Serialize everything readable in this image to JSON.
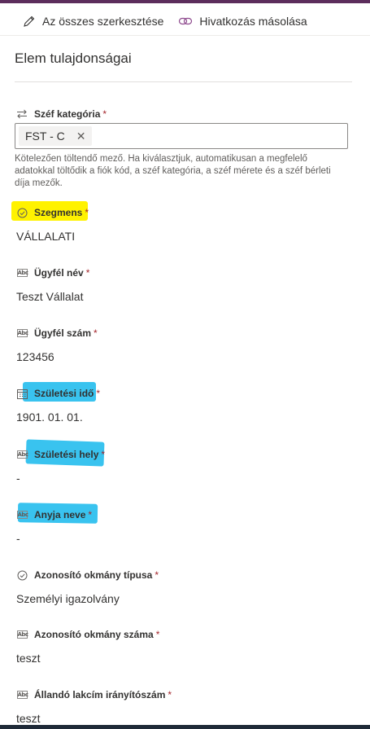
{
  "toolbar": {
    "edit_all_label": "Az összes szerkesztése",
    "copy_link_label": "Hivatkozás másolása"
  },
  "panel": {
    "title": "Elem tulajdonságai"
  },
  "fields": {
    "safe_category": {
      "label": "Széf kategória",
      "required": "*",
      "chip": "FST - C",
      "help": "Kötelezően töltendő mező. Ha kiválasztjuk, automatikusan a megfelelő adatokkal töltődik a fiók kód, a széf kategória, a széf mérete és a széf bérleti díja mezők."
    },
    "segment": {
      "label": "Szegmens",
      "required": "*",
      "value": "VÁLLALATI"
    },
    "client_name": {
      "label": "Ügyfél név",
      "required": "*",
      "value": "Teszt Vállalat"
    },
    "client_number": {
      "label": "Ügyfél szám",
      "required": "*",
      "value": "123456"
    },
    "birth_date": {
      "label": "Születési idő",
      "required": "*",
      "value": "1901. 01. 01."
    },
    "birth_place": {
      "label": "Születési hely",
      "required": "*",
      "value": "-"
    },
    "mother_name": {
      "label": "Anyja neve",
      "required": "*",
      "value": "-"
    },
    "id_doc_type": {
      "label": "Azonosító okmány típusa",
      "required": "*",
      "value": "Személyi igazolvány"
    },
    "id_doc_number": {
      "label": "Azonosító okmány száma",
      "required": "*",
      "value": "teszt"
    },
    "postal_code": {
      "label": "Állandó lakcím irányítószám",
      "required": "*",
      "value": "teszt"
    }
  },
  "colors": {
    "highlight_yellow": "#fff200",
    "highlight_blue": "#39c3ef",
    "required": "#a4262c"
  }
}
